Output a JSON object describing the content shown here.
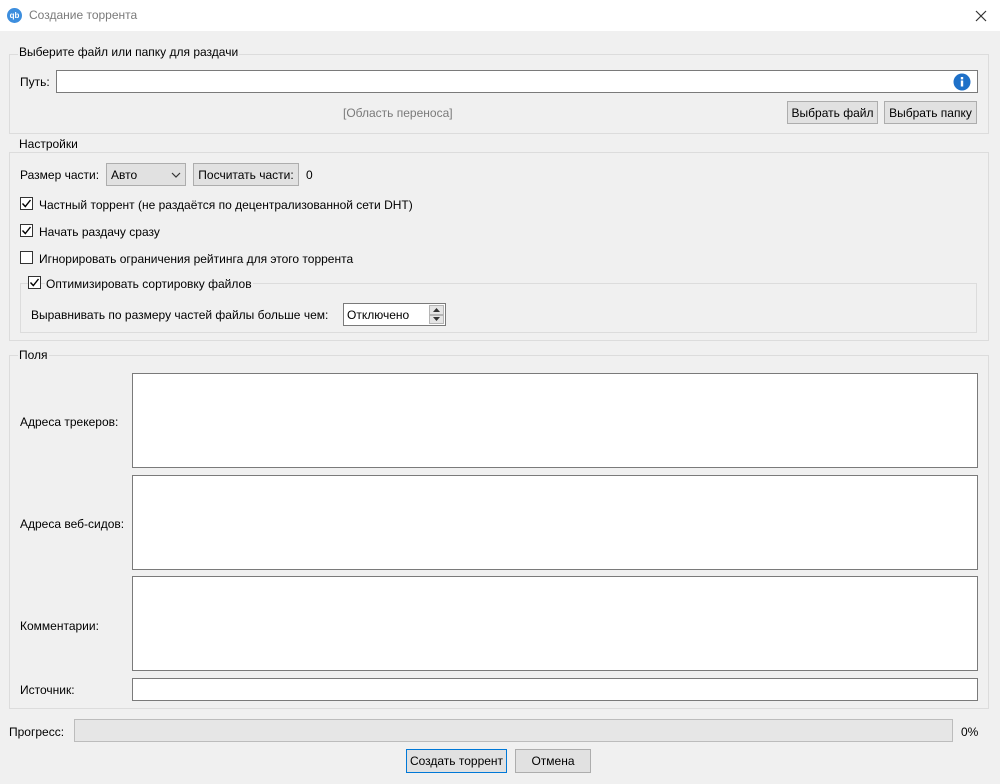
{
  "window": {
    "title": "Создание торрента",
    "app_icon_text": "qb"
  },
  "source_group": {
    "title": "Выберите файл или папку для раздачи",
    "path_label": "Путь:",
    "path_value": "",
    "drop_area": "[Область переноса]",
    "select_file_label": "Выбрать файл",
    "select_folder_label": "Выбрать папку"
  },
  "settings_group": {
    "title": "Настройки",
    "piece_size_label": "Размер части:",
    "piece_size_value": "Авто",
    "calc_pieces_label": "Посчитать части:",
    "pieces_count": "0",
    "private_torrent": {
      "label": "Частный торрент (не раздаётся по децентрализованной сети DHT)",
      "checked": true
    },
    "start_seeding": {
      "label": "Начать раздачу сразу",
      "checked": true
    },
    "ignore_ratio": {
      "label": "Игнорировать ограничения рейтинга для этого торрента",
      "checked": false
    },
    "optimize_sort": {
      "label": "Оптимизировать сортировку файлов",
      "checked": true
    },
    "align_label": "Выравнивать по размеру частей файлы больше чем:",
    "align_value": "Отключено"
  },
  "fields_group": {
    "title": "Поля",
    "trackers_label": "Адреса трекеров:",
    "webseeds_label": "Адреса веб-сидов:",
    "comments_label": "Комментарии:",
    "source_label": "Источник:",
    "source_value": ""
  },
  "progress": {
    "label": "Прогресс:",
    "value_text": "0%",
    "fraction": 0
  },
  "footer": {
    "create_label": "Создать торрент",
    "cancel_label": "Отмена"
  },
  "colors": {
    "info_icon": "#1e70c8",
    "app_icon": "#3d8ede"
  }
}
